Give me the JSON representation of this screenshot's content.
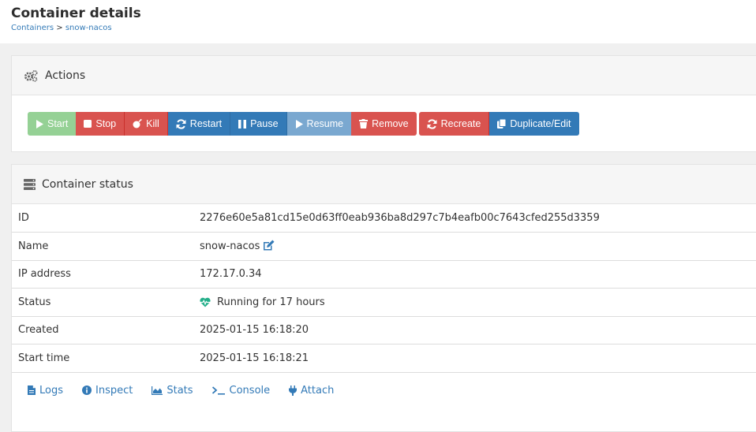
{
  "header": {
    "title": "Container details",
    "breadcrumb": {
      "root": "Containers",
      "separator": ">",
      "current": "snow-nacos"
    }
  },
  "actions": {
    "title": "Actions",
    "buttons": {
      "start": "Start",
      "stop": "Stop",
      "kill": "Kill",
      "restart": "Restart",
      "pause": "Pause",
      "resume": "Resume",
      "remove": "Remove",
      "recreate": "Recreate",
      "duplicate": "Duplicate/Edit"
    }
  },
  "status": {
    "title": "Container status",
    "rows": {
      "id": {
        "label": "ID",
        "value": "2276e60e5a81cd15e0d63ff0eab936ba8d297c7b4eafb00c7643cfed255d3359"
      },
      "name": {
        "label": "Name",
        "value": "snow-nacos"
      },
      "ip": {
        "label": "IP address",
        "value": "172.17.0.34"
      },
      "status": {
        "label": "Status",
        "value": "Running for 17 hours"
      },
      "created": {
        "label": "Created",
        "value": "2025-01-15 16:18:20"
      },
      "start_time": {
        "label": "Start time",
        "value": "2025-01-15 16:18:21"
      }
    },
    "links": {
      "logs": "Logs",
      "inspect": "Inspect",
      "stats": "Stats",
      "console": "Console",
      "attach": "Attach"
    }
  },
  "colors": {
    "link": "#337ab7",
    "success": "#5cb85c",
    "danger": "#d9534f",
    "primary": "#337ab7",
    "running": "#23ae89"
  }
}
